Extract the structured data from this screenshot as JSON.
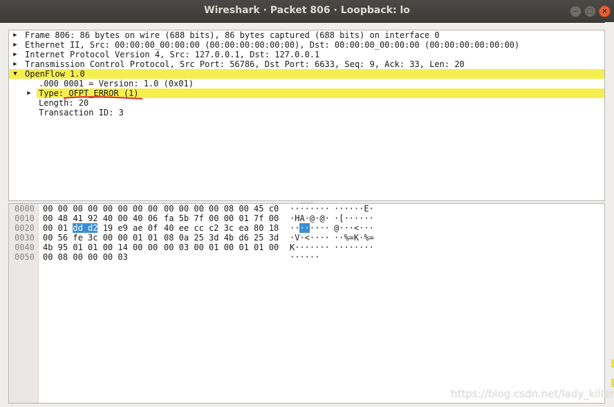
{
  "window": {
    "title": "Wireshark · Packet 806 · Loopback: lo",
    "minimize_glyph": "–",
    "maximize_glyph": "□",
    "close_glyph": "×"
  },
  "tree": {
    "items": [
      {
        "text": "Frame 806: 86 bytes on wire (688 bits), 86 bytes captured (688 bits) on interface 0",
        "state": "collapsed"
      },
      {
        "text": "Ethernet II, Src: 00:00:00_00:00:00 (00:00:00:00:00:00), Dst: 00:00:00_00:00:00 (00:00:00:00:00:00)",
        "state": "collapsed"
      },
      {
        "text": "Internet Protocol Version 4, Src: 127.0.0.1, Dst: 127.0.0.1",
        "state": "collapsed"
      },
      {
        "text": "Transmission Control Protocol, Src Port: 56786, Dst Port: 6633, Seq: 9, Ack: 33, Len: 20",
        "state": "collapsed"
      },
      {
        "text": "OpenFlow 1.0",
        "state": "expanded"
      }
    ],
    "openflow_children": [
      {
        "text": ".000 0001 = Version: 1.0 (0x01)",
        "state": "leaf"
      },
      {
        "text": "Type: OFPT_ERROR (1)",
        "state": "collapsed"
      },
      {
        "text": "Length: 20",
        "state": "leaf"
      },
      {
        "text": "Transaction ID: 3",
        "state": "leaf"
      }
    ],
    "expand_glyph": "▶",
    "collapse_glyph": "▼"
  },
  "hex": {
    "rows": [
      {
        "offset": "0000",
        "b1": "00 00 00 00 00 00 00 00",
        "b2": "00 00 00 00 08 00 45 c0",
        "a1": "········",
        "a2": "······E·"
      },
      {
        "offset": "0010",
        "b1": "00 48 41 92 40 00 40 06",
        "b2": "fa 5b 7f 00 00 01 7f 00",
        "a1": "·HA·@·@·",
        "a2": "·[······"
      },
      {
        "offset": "0020",
        "b1_pre": "00 01 ",
        "b1_sel": "dd d2",
        "b1_post": " 19 e9 ae 0f",
        "b2": "40 ee cc c2 3c ea 80 18",
        "a1_pre": "··",
        "a1_sel": "··",
        "a1_post": "····",
        "a2": "@···<···"
      },
      {
        "offset": "0030",
        "b1": "00 56 fe 3c 00 00 01 01",
        "b2": "08 0a 25 3d 4b d6 25 3d",
        "a1": "·V·<····",
        "a2": "··%=K·%="
      },
      {
        "offset": "0040",
        "b1": "4b 95 01 01 00 14 00 00",
        "b2": "00 03 00 01 00 01 01 00",
        "a1": "K·······",
        "a2": "········"
      },
      {
        "offset": "0050",
        "b1": "00 08 00 00 00 03",
        "b2": "",
        "a1": "······",
        "a2": ""
      }
    ]
  },
  "watermark": "https://blog.csdn.net/lady_killer9",
  "colors": {
    "highlight": "#f5ee4f",
    "selection": "#3a8fd3",
    "annotation_underline": "#e0262a"
  }
}
